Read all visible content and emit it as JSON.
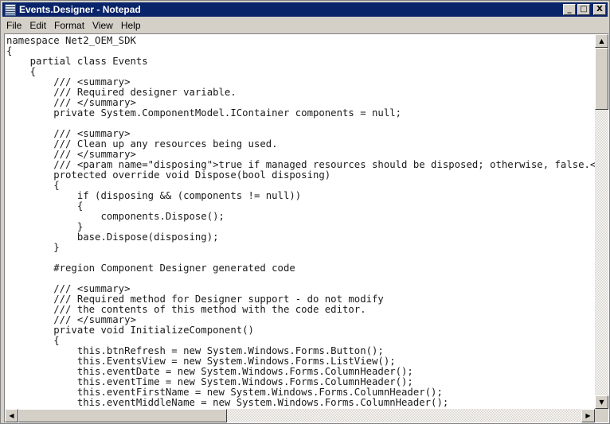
{
  "window": {
    "title": "Events.Designer - Notepad"
  },
  "controls": {
    "minimize": "_",
    "maximize": "□",
    "close": "X"
  },
  "menu": [
    {
      "key": "F",
      "rest": "ile"
    },
    {
      "key": "E",
      "rest": "dit"
    },
    {
      "key": "",
      "pre": "F",
      "key2": "o",
      "rest": "rmat"
    },
    {
      "key": "V",
      "rest": "iew"
    },
    {
      "key": "H",
      "rest": "elp"
    }
  ],
  "menu_labels": [
    "File",
    "Edit",
    "Format",
    "View",
    "Help"
  ],
  "scroll": {
    "vertical_position": 0.0,
    "horizontal_position": 0.0,
    "up": "▲",
    "down": "▼",
    "left": "◀",
    "right": "▶"
  },
  "code_lines": [
    "namespace Net2_OEM_SDK",
    "{",
    "    partial class Events",
    "    {",
    "        /// <summary>",
    "        /// Required designer variable.",
    "        /// </summary>",
    "        private System.ComponentModel.IContainer components = null;",
    "",
    "        /// <summary>",
    "        /// Clean up any resources being used.",
    "        /// </summary>",
    "        /// <param name=\"disposing\">true if managed resources should be disposed; otherwise, false.</param>",
    "        protected override void Dispose(bool disposing)",
    "        {",
    "            if (disposing && (components != null))",
    "            {",
    "                components.Dispose();",
    "            }",
    "            base.Dispose(disposing);",
    "        }",
    "",
    "        #region Component Designer generated code",
    "",
    "        /// <summary>",
    "        /// Required method for Designer support - do not modify",
    "        /// the contents of this method with the code editor.",
    "        /// </summary>",
    "        private void InitializeComponent()",
    "        {",
    "            this.btnRefresh = new System.Windows.Forms.Button();",
    "            this.EventsView = new System.Windows.Forms.ListView();",
    "            this.eventDate = new System.Windows.Forms.ColumnHeader();",
    "            this.eventTime = new System.Windows.Forms.ColumnHeader();",
    "            this.eventFirstName = new System.Windows.Forms.ColumnHeader();",
    "            this.eventMiddleName = new System.Windows.Forms.ColumnHeader();"
  ]
}
